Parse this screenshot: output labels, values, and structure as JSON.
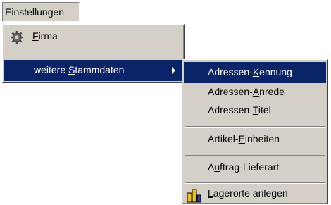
{
  "menubar": {
    "title": "Einstellungen"
  },
  "menu1": {
    "items": [
      {
        "pre": "",
        "ul": "F",
        "post": "irma",
        "icon": "gear-icon"
      },
      {
        "pre": "weitere ",
        "ul": "S",
        "post": "tammdaten",
        "submenu_arrow": "chevron-right-icon"
      }
    ]
  },
  "menu2": {
    "items": [
      {
        "pre": "Adressen-",
        "ul": "K",
        "post": "ennung"
      },
      {
        "pre": "Adressen-",
        "ul": "A",
        "post": "nrede"
      },
      {
        "pre": "Adressen-",
        "ul": "T",
        "post": "itel"
      },
      {
        "pre": "Artikel-",
        "ul": "E",
        "post": "inheiten"
      },
      {
        "pre": "A",
        "ul": "u",
        "post": "ftrag-Lieferart"
      },
      {
        "pre": "",
        "ul": "L",
        "post": "agerorte anlegen",
        "icon": "storage-icon"
      }
    ]
  },
  "colors": {
    "menu_bg": "#d4d0c8",
    "highlight": "#0a246a",
    "highlight_text": "#ffffff"
  }
}
